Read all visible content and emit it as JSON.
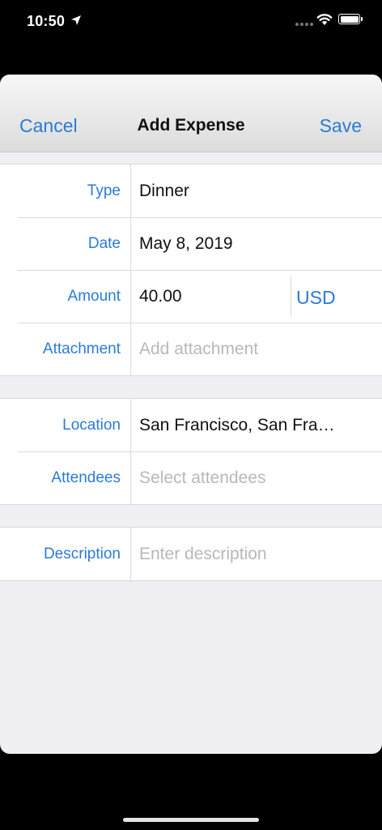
{
  "status_bar": {
    "time": "10:50"
  },
  "nav": {
    "cancel": "Cancel",
    "title": "Add Expense",
    "save": "Save"
  },
  "section1": {
    "type": {
      "label": "Type",
      "value": "Dinner"
    },
    "date": {
      "label": "Date",
      "value": "May 8, 2019"
    },
    "amount": {
      "label": "Amount",
      "value": "40.00",
      "currency": "USD"
    },
    "attachment": {
      "label": "Attachment",
      "placeholder": "Add attachment"
    }
  },
  "section2": {
    "location": {
      "label": "Location",
      "value": "San Francisco, San Fra…"
    },
    "attendees": {
      "label": "Attendees",
      "placeholder": "Select attendees"
    }
  },
  "section3": {
    "description": {
      "label": "Description",
      "placeholder": "Enter description"
    }
  },
  "colors": {
    "accent": "#2a7bd6",
    "background": "#efeff4",
    "placeholder": "#b8b8bc"
  }
}
